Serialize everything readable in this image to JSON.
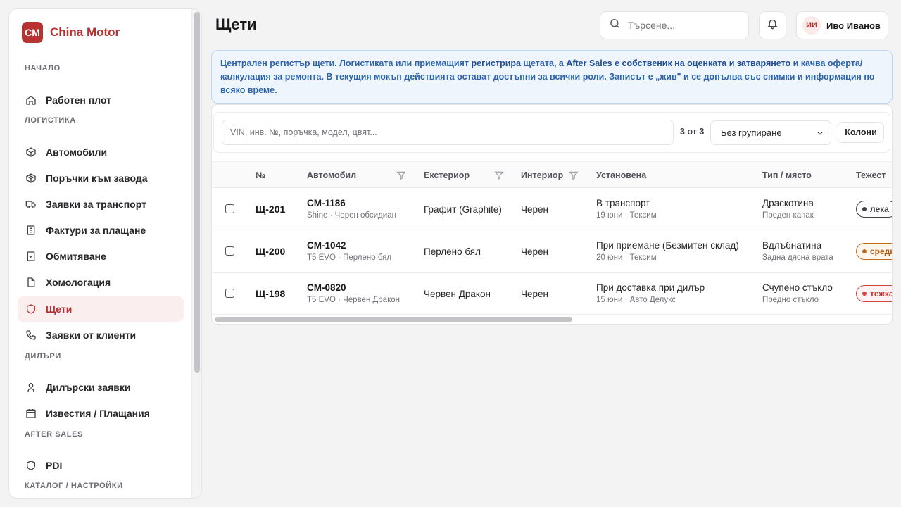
{
  "brand": {
    "logo": "CM",
    "name": "China Motor"
  },
  "sidebar": {
    "sections": [
      {
        "title": "НАЧАЛО",
        "items": [
          {
            "label": "Работен плот",
            "icon": "home-icon"
          }
        ]
      },
      {
        "title": "ЛОГИСТИКА",
        "items": [
          {
            "label": "Автомобили",
            "icon": "box-icon"
          },
          {
            "label": "Поръчки към завода",
            "icon": "package-icon"
          },
          {
            "label": "Заявки за транспорт",
            "icon": "truck-icon"
          },
          {
            "label": "Фактури за плащане",
            "icon": "invoice-icon"
          },
          {
            "label": "Обмитяване",
            "icon": "file-check-icon"
          },
          {
            "label": "Хомологация",
            "icon": "document-icon"
          },
          {
            "label": "Щети",
            "icon": "shield-icon",
            "active": true
          },
          {
            "label": "Заявки от клиенти",
            "icon": "phone-icon"
          }
        ]
      },
      {
        "title": "ДИЛЪРИ",
        "items": [
          {
            "label": "Дилърски заявки",
            "icon": "user-icon"
          },
          {
            "label": "Известия / Плащания",
            "icon": "calendar-icon"
          }
        ]
      },
      {
        "title": "AFTER SALES",
        "items": [
          {
            "label": "PDI",
            "icon": "shield-icon"
          }
        ]
      },
      {
        "title": "КАТАЛОГ / НАСТРОЙКИ",
        "items": []
      }
    ]
  },
  "header": {
    "title": "Щети",
    "search_placeholder": "Търсене...",
    "user_initials": "ИИ",
    "user_name": "Иво Иванов"
  },
  "banner": {
    "part1": "Централен регистър щети. Логистиката или приемащият ",
    "bold1": "регистрира",
    "part2": " щетата, а ",
    "bold2": "After Sales е собственик на оценката и затварянето",
    "part3": " и качва оферта/калкулация за ремонта. В текущия мокъп действията остават достъпни за всички роли. Записът е „жив\" и се допълва със снимки и информация по всяко време."
  },
  "toolbar": {
    "filter_placeholder": "VIN, инв. №, поръчка, модел, цвят...",
    "count": "3 от 3",
    "grouping": "Без групиране",
    "columns_button": "Колони"
  },
  "table": {
    "columns": [
      "№",
      "Автомобил",
      "Екстериор",
      "Интериор",
      "Установена",
      "Тип / място",
      "Тежест"
    ],
    "rows": [
      {
        "id": "Щ-201",
        "car": "CM-1186",
        "car_sub": "Shine · Черен обсидиан",
        "exterior": "Графит (Graphite)",
        "interior": "Черен",
        "found": "В транспорт",
        "found_sub": "19 юни · Тексим",
        "type": "Драскотина",
        "type_sub": "Преден капак",
        "severity": "лека",
        "severity_level": "light"
      },
      {
        "id": "Щ-200",
        "car": "CM-1042",
        "car_sub": "T5 EVO · Перлено бял",
        "exterior": "Перлено бял",
        "interior": "Черен",
        "found": "При приемане (Безмитен склад)",
        "found_sub": "20 юни · Тексим",
        "type": "Вдлъбнатина",
        "type_sub": "Задна дясна врата",
        "severity": "средна",
        "severity_level": "medium"
      },
      {
        "id": "Щ-198",
        "car": "CM-0820",
        "car_sub": "T5 EVO · Червен Дракон",
        "exterior": "Червен Дракон",
        "interior": "Черен",
        "found": "При доставка при дилър",
        "found_sub": "15 юни · Авто Делукс",
        "type": "Счупено стъкло",
        "type_sub": "Предно стъкло",
        "severity": "тежка",
        "severity_level": "heavy"
      }
    ]
  }
}
